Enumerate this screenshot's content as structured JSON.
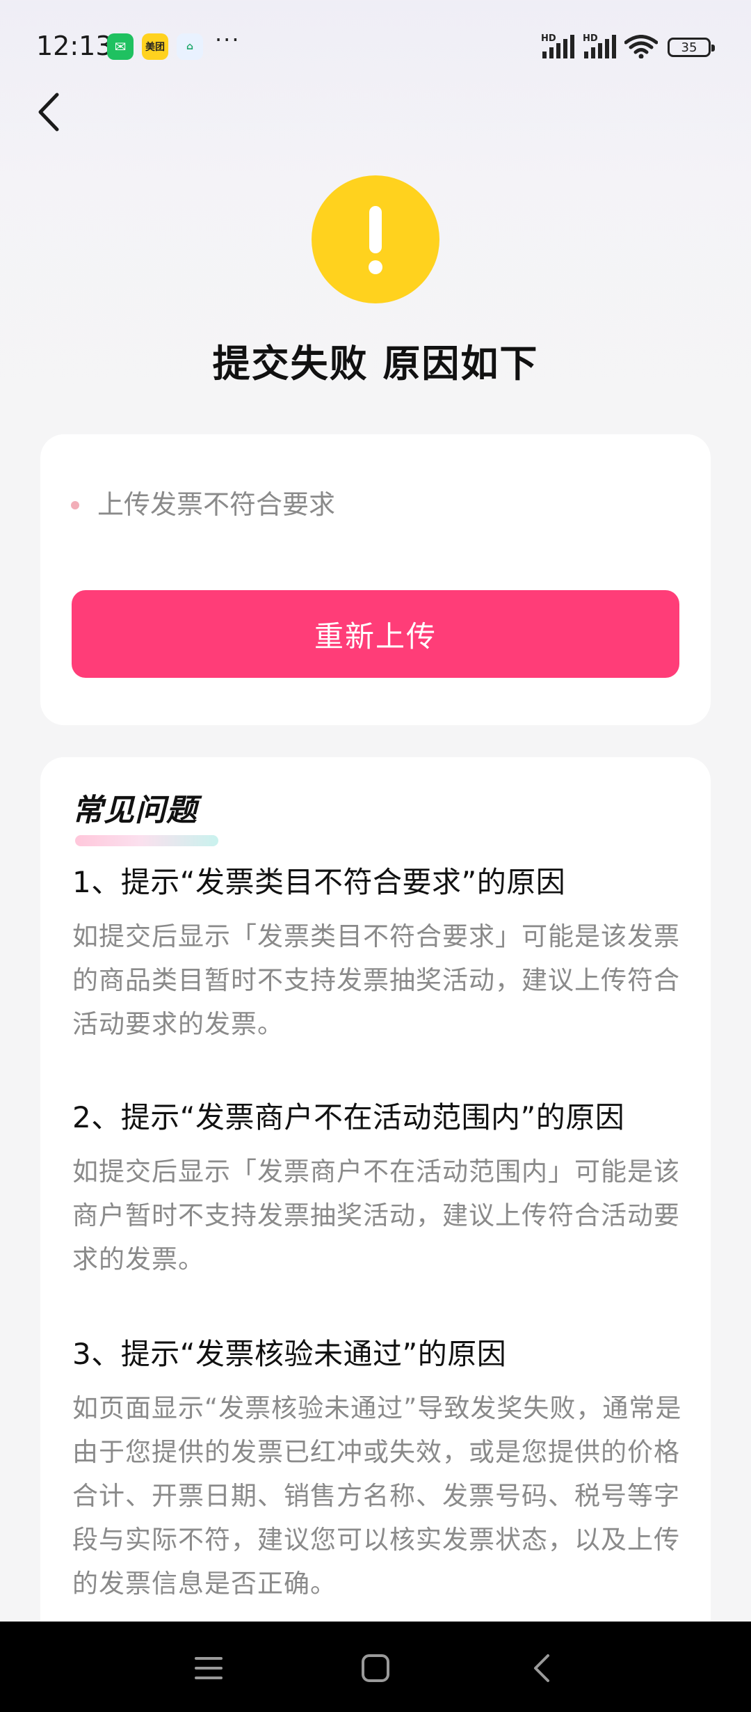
{
  "status_bar": {
    "time": "12:13",
    "apps": [
      {
        "name": "wechat-icon",
        "glyph": "✉"
      },
      {
        "name": "meituan-icon",
        "glyph": "美团"
      },
      {
        "name": "home-app-icon",
        "glyph": "⌂"
      }
    ],
    "more": "···",
    "hd1": "HD",
    "hd2": "HD",
    "battery": "35"
  },
  "page": {
    "title": "提交失败 原因如下",
    "warning_color": "#ffd21e"
  },
  "reason": {
    "text": "上传发票不符合要求",
    "button_label": "重新上传",
    "button_color": "#ff3d78"
  },
  "faq": {
    "title": "常见问题",
    "items": [
      {
        "question": "1、提示“发票类目不符合要求”的原因",
        "answer": "如提交后显示「发票类目不符合要求」可能是该发票的商品类目暂时不支持发票抽奖活动，建议上传符合活动要求的发票。"
      },
      {
        "question": "2、提示“发票商户不在活动范围内”的原因",
        "answer": "如提交后显示「发票商户不在活动范围内」可能是该商户暂时不支持发票抽奖活动，建议上传符合活动要求的发票。"
      },
      {
        "question": "3、提示“发票核验未通过”的原因",
        "answer": "如页面显示“发票核验未通过”导致发奖失败，通常是由于您提供的发票已红冲或失效，或是您提供的价格合计、开票日期、销售方名称、发票号码、税号等字段与实际不符，建议您可以核实发票状态，以及上传的发票信息是否正确。"
      }
    ]
  },
  "nav": {
    "icons": [
      "menu-icon",
      "home-square-icon",
      "back-arrow-icon"
    ]
  }
}
